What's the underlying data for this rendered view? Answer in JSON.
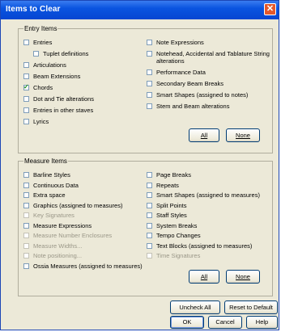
{
  "window": {
    "title": "Items to Clear",
    "close_glyph": "✕"
  },
  "entry": {
    "label": "Entry Items",
    "left": [
      {
        "label": "Entries",
        "checked": false,
        "disabled": false
      },
      {
        "label": "Tuplet definitions",
        "checked": false,
        "disabled": false,
        "indent": true
      },
      {
        "label": "Articulations",
        "checked": false,
        "disabled": false
      },
      {
        "label": "Beam Extensions",
        "checked": false,
        "disabled": false
      },
      {
        "label": "Chords",
        "checked": true,
        "disabled": false
      },
      {
        "label": "Dot and Tie alterations",
        "checked": false,
        "disabled": false
      },
      {
        "label": "Entries in other staves",
        "checked": false,
        "disabled": false
      },
      {
        "label": "Lyrics",
        "checked": false,
        "disabled": false
      }
    ],
    "right": [
      {
        "label": "Note Expressions",
        "checked": false,
        "disabled": false
      },
      {
        "label": "Notehead, Accidental and Tablature String alterations",
        "checked": false,
        "disabled": false
      },
      {
        "label": "Performance Data",
        "checked": false,
        "disabled": false
      },
      {
        "label": "Secondary Beam Breaks",
        "checked": false,
        "disabled": false
      },
      {
        "label": "Smart Shapes (assigned to notes)",
        "checked": false,
        "disabled": false
      },
      {
        "label": "Stem and Beam alterations",
        "checked": false,
        "disabled": false
      }
    ],
    "all_label": "All",
    "none_label": "None"
  },
  "measure": {
    "label": "Measure Items",
    "left": [
      {
        "label": "Barline Styles",
        "checked": false,
        "disabled": false
      },
      {
        "label": "Continuous Data",
        "checked": false,
        "disabled": false
      },
      {
        "label": "Extra space",
        "checked": false,
        "disabled": false
      },
      {
        "label": "Graphics (assigned to measures)",
        "checked": false,
        "disabled": false
      },
      {
        "label": "Key Signatures",
        "checked": false,
        "disabled": true
      },
      {
        "label": "Measure Expressions",
        "checked": false,
        "disabled": false
      },
      {
        "label": "Measure Number Enclosures",
        "checked": false,
        "disabled": true
      },
      {
        "label": "Measure Widths...",
        "checked": false,
        "disabled": true
      },
      {
        "label": "Note positioning...",
        "checked": false,
        "disabled": true
      },
      {
        "label": "Ossia Measures (assigned to measures)",
        "checked": false,
        "disabled": false
      }
    ],
    "right": [
      {
        "label": "Page Breaks",
        "checked": false,
        "disabled": false
      },
      {
        "label": "Repeats",
        "checked": false,
        "disabled": false
      },
      {
        "label": "Smart Shapes (assigned to measures)",
        "checked": false,
        "disabled": false
      },
      {
        "label": "Split Points",
        "checked": false,
        "disabled": false
      },
      {
        "label": "Staff Styles",
        "checked": false,
        "disabled": false
      },
      {
        "label": "System Breaks",
        "checked": false,
        "disabled": false
      },
      {
        "label": "Tempo Changes",
        "checked": false,
        "disabled": false
      },
      {
        "label": "Text Blocks (assigned to measures)",
        "checked": false,
        "disabled": false
      },
      {
        "label": "Time Signatures",
        "checked": false,
        "disabled": true
      }
    ],
    "all_label": "All",
    "none_label": "None"
  },
  "footer": {
    "uncheck_all_label": "Uncheck All",
    "reset_label": "Reset to Default",
    "ok_label": "OK",
    "cancel_label": "Cancel",
    "help_label": "Help"
  }
}
